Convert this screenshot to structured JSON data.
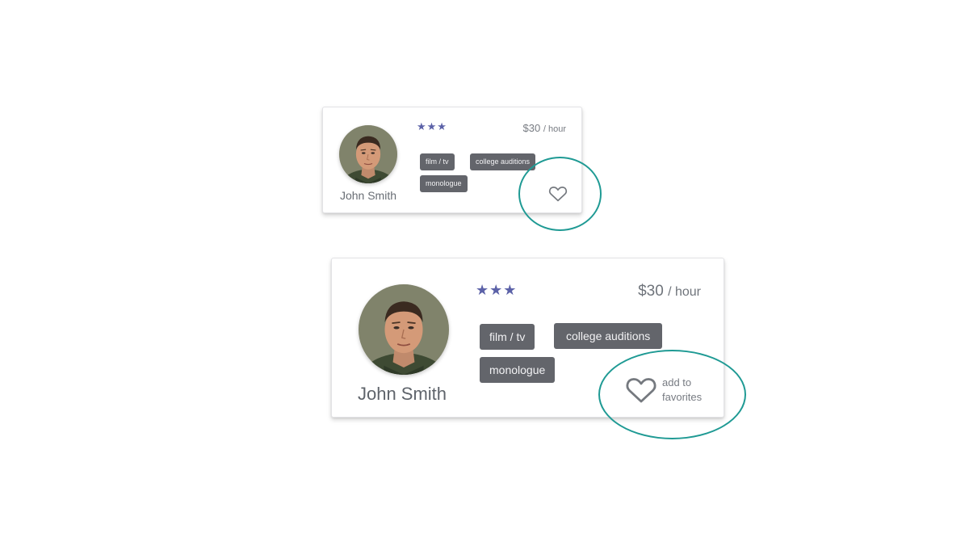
{
  "colors": {
    "star": "#5c62a8",
    "tag_background": "#63656b",
    "callout_ring": "#1f9a94"
  },
  "card_small": {
    "name": "John Smith",
    "rating_stars": 3,
    "stars": "★★★",
    "price": "$30",
    "price_unit": "/ hour",
    "tags": [
      "film / tv",
      "college auditions",
      "monologue"
    ],
    "favorite_icon": "heart-icon"
  },
  "card_large": {
    "name": "John Smith",
    "rating_stars": 3,
    "stars": "★★★",
    "price": "$30",
    "price_unit": "/ hour",
    "tags": [
      "film / tv",
      "college auditions",
      "monologue"
    ],
    "favorite_icon": "heart-icon",
    "favorite_label_line1": "add to",
    "favorite_label_line2": "favorites"
  }
}
